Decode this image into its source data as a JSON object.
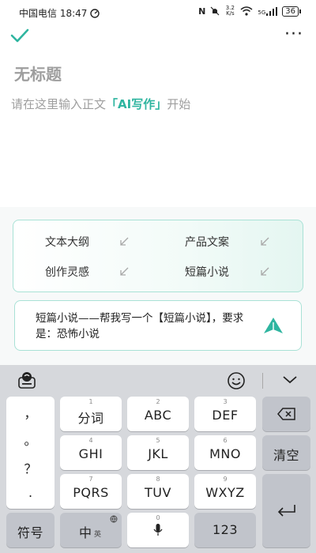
{
  "status_bar": {
    "carrier_time": "中国电信 18:47",
    "net_speed": "3.2 K/s",
    "network": "5G",
    "battery": "36"
  },
  "editor": {
    "title_placeholder": "无标题",
    "body_placeholder_prefix": "请在这里输入正文",
    "body_placeholder_link": "「AI写作」",
    "body_placeholder_suffix": "开始"
  },
  "ai_panel": {
    "prompts": [
      "文本大纲",
      "产品文案",
      "创作灵感",
      "短篇小说"
    ],
    "request_text": "短篇小说——帮我写一个【短篇小说】，要求是：恐怖小说"
  },
  "keyboard": {
    "punctuation": [
      "，",
      "。",
      "？",
      "."
    ],
    "rows": [
      [
        {
          "num": "1",
          "label": "分词"
        },
        {
          "num": "2",
          "label": "ABC"
        },
        {
          "num": "3",
          "label": "DEF"
        }
      ],
      [
        {
          "num": "4",
          "label": "GHI"
        },
        {
          "num": "5",
          "label": "JKL"
        },
        {
          "num": "6",
          "label": "MNO"
        }
      ],
      [
        {
          "num": "7",
          "label": "PQRS"
        },
        {
          "num": "8",
          "label": "TUV"
        },
        {
          "num": "9",
          "label": "WXYZ"
        }
      ]
    ],
    "backspace_icon": "backspace-icon",
    "clear_label": "清空",
    "enter_icon": "enter-icon",
    "symbols_label": "符号",
    "lang_label": "中",
    "lang_sub": "英",
    "space_num": "0",
    "numbers_label": "123",
    "accent": "#2fb5a0"
  }
}
